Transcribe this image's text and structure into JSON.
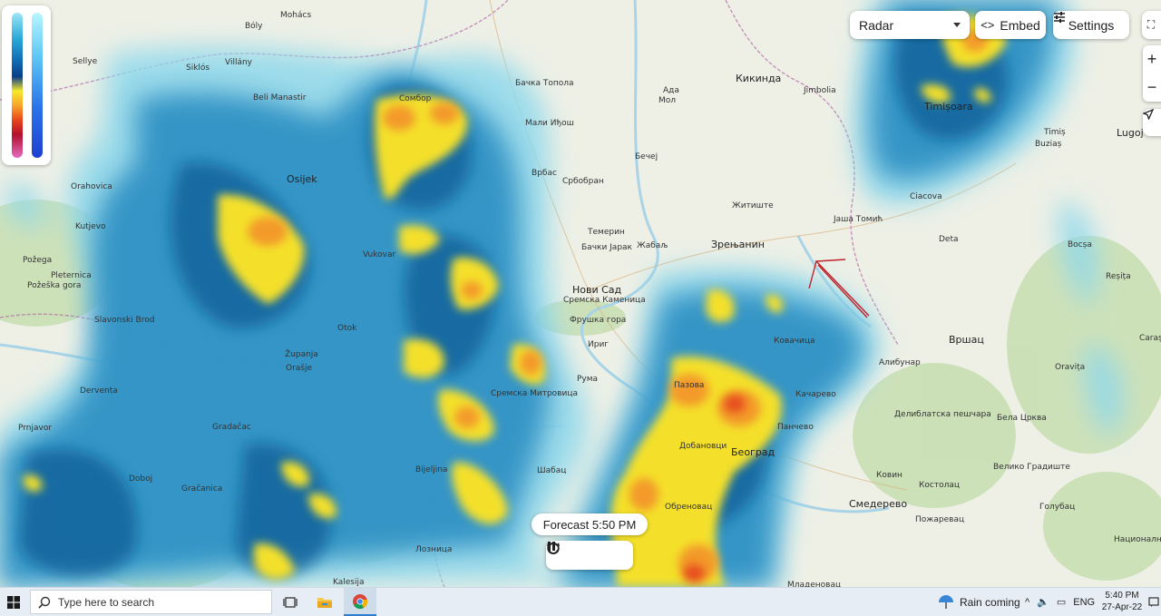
{
  "legend": {
    "precip_icon": "precip-scale",
    "snow_icon": "snow-scale"
  },
  "controls": {
    "layer_select_value": "Radar",
    "embed_label": "Embed",
    "settings_label": "Settings",
    "zoom_in": "+",
    "zoom_out": "−"
  },
  "timeline": {
    "forecast_label": "Forecast 5:50 PM"
  },
  "map_labels": [
    {
      "name": "Mohács",
      "big": false
    },
    {
      "name": "Bóly",
      "big": false
    },
    {
      "name": "Sellye",
      "big": false
    },
    {
      "name": "Siklós",
      "big": false
    },
    {
      "name": "Villány",
      "big": false
    },
    {
      "name": "Beli Manastir",
      "big": false
    },
    {
      "name": "Osijek",
      "big": true
    },
    {
      "name": "Orahovica",
      "big": false
    },
    {
      "name": "Kutjevo",
      "big": false
    },
    {
      "name": "Požega",
      "big": false
    },
    {
      "name": "Pleternica",
      "big": false
    },
    {
      "name": "Požeška gora",
      "big": false
    },
    {
      "name": "Slavonski Brod",
      "big": false
    },
    {
      "name": "Vukovar",
      "big": false
    },
    {
      "name": "Otok",
      "big": false
    },
    {
      "name": "Županja",
      "big": false
    },
    {
      "name": "Orašje",
      "big": false
    },
    {
      "name": "Derventa",
      "big": false
    },
    {
      "name": "Prnjavor",
      "big": false
    },
    {
      "name": "Doboj",
      "big": false
    },
    {
      "name": "Gračanica",
      "big": false
    },
    {
      "name": "Bijeljina",
      "big": false
    },
    {
      "name": "Лозница",
      "big": false
    },
    {
      "name": "Kalesija",
      "big": false
    },
    {
      "name": "Gradačac",
      "big": false
    },
    {
      "name": "Сомбор",
      "big": false
    },
    {
      "name": "Бачка Топола",
      "big": false
    },
    {
      "name": "Мали Иђош",
      "big": false
    },
    {
      "name": "Врбас",
      "big": false
    },
    {
      "name": "Србобран",
      "big": false
    },
    {
      "name": "Бечеј",
      "big": false
    },
    {
      "name": "Ада",
      "big": false
    },
    {
      "name": "Мол",
      "big": false
    },
    {
      "name": "Кикинда",
      "big": true
    },
    {
      "name": "Jimbolia",
      "big": false
    },
    {
      "name": "Темерин",
      "big": false
    },
    {
      "name": "Бачки Јарак",
      "big": false
    },
    {
      "name": "Жабаљ",
      "big": false
    },
    {
      "name": "Нови Сад",
      "big": true
    },
    {
      "name": "Сремска Каменица",
      "big": false
    },
    {
      "name": "Фрушка гора",
      "big": false
    },
    {
      "name": "Ириг",
      "big": false
    },
    {
      "name": "Рума",
      "big": false
    },
    {
      "name": "Сремска Митровица",
      "big": false
    },
    {
      "name": "Шабац",
      "big": false
    },
    {
      "name": "Житиште",
      "big": false
    },
    {
      "name": "Зрењанин",
      "big": true
    },
    {
      "name": "Јаша Томић",
      "big": false
    },
    {
      "name": "Deta",
      "big": false
    },
    {
      "name": "Вршац",
      "big": true
    },
    {
      "name": "Ковачица",
      "big": false
    },
    {
      "name": "Качарево",
      "big": false
    },
    {
      "name": "Алибунар",
      "big": false
    },
    {
      "name": "Панчево",
      "big": false
    },
    {
      "name": "Београд",
      "big": true
    },
    {
      "name": "Пазова",
      "big": false
    },
    {
      "name": "Обреновац",
      "big": false
    },
    {
      "name": "Ковин",
      "big": false
    },
    {
      "name": "Смедерево",
      "big": true
    },
    {
      "name": "Костолац",
      "big": false
    },
    {
      "name": "Пожаревац",
      "big": false
    },
    {
      "name": "Бела Црква",
      "big": false
    },
    {
      "name": "Велико Градиште",
      "big": false
    },
    {
      "name": "Голубац",
      "big": false
    },
    {
      "name": "Делиблатска пешчара",
      "big": false
    },
    {
      "name": "Младеновац",
      "big": false
    },
    {
      "name": "Timișoara",
      "big": true
    },
    {
      "name": "Buziaș",
      "big": false
    },
    {
      "name": "Lugoj",
      "big": true
    },
    {
      "name": "Ciacova",
      "big": false
    },
    {
      "name": "Timiș",
      "big": false
    },
    {
      "name": "Bocșa",
      "big": false
    },
    {
      "name": "Reșița",
      "big": false
    },
    {
      "name": "Oravița",
      "big": false
    },
    {
      "name": "Caraș",
      "big": false
    },
    {
      "name": "Национални парк Ђердап",
      "big": false
    },
    {
      "name": "Добановци",
      "big": false
    }
  ],
  "taskbar": {
    "search_placeholder": "Type here to search",
    "weather_text": "Rain coming",
    "lang": "ENG",
    "time": "5:40 PM",
    "date": "27-Apr-22"
  }
}
